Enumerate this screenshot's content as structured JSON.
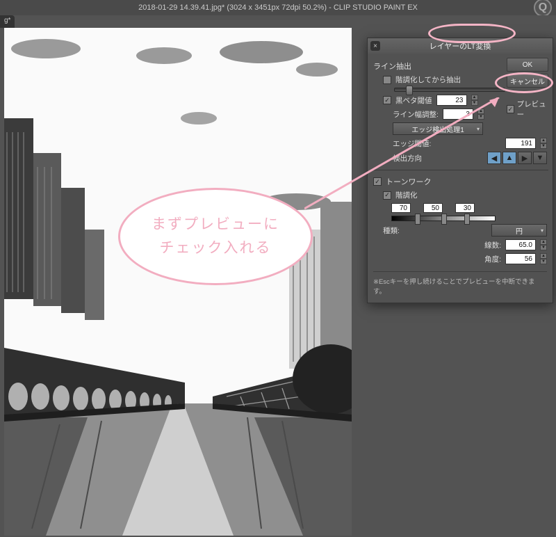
{
  "titlebar": {
    "title": "2018-01-29 14.39.41.jpg* (3024 x 3451px 72dpi 50.2%) - CLIP STUDIO PAINT EX",
    "q_icon": "Q"
  },
  "tab": {
    "label": "g*"
  },
  "dialog": {
    "title": "レイヤーのLT変換",
    "ok": "OK",
    "cancel": "キャンセル",
    "preview_label": "プレビュー",
    "preview_checked": true,
    "line_extract_title": "ライン抽出",
    "posterize_then_extract_label": "階調化してから抽出",
    "posterize_then_extract_checked": false,
    "black_fill_label": "黒ベタ閾値",
    "black_fill_checked": true,
    "black_fill_value": "23",
    "line_width_label": "ライン幅調整:",
    "line_width_value": "3",
    "edge_detect_label": "エッジ検出処理1",
    "edge_threshold_label": "エッジ閾値:",
    "edge_threshold_value": "191",
    "detect_dir_label": "検出方向",
    "tone_work_title": "トーンワーク",
    "tone_work_checked": true,
    "posterize_label": "階調化",
    "posterize_checked": true,
    "posterize_values": [
      "70",
      "50",
      "30"
    ],
    "type_label": "種類:",
    "type_value": "円",
    "lines_label": "線数:",
    "lines_value": "65.0",
    "angle_label": "角度:",
    "angle_value": "56",
    "note": "※Escキーを押し続けることでプレビューを中断できます。"
  },
  "annotation": {
    "speech_line1": "まずプレビューに",
    "speech_line2": "チェック入れる"
  }
}
